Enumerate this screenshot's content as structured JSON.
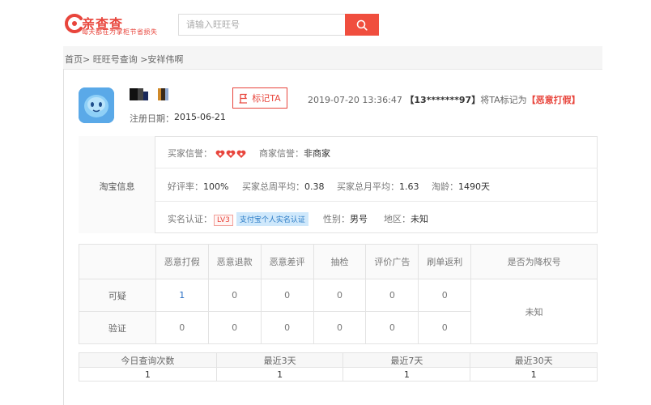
{
  "brand": {
    "title": "亲查查",
    "slogan": "每天都在为掌柜节省损失",
    "color": "#e8453c"
  },
  "search": {
    "placeholder": "请输入旺旺号"
  },
  "breadcrumb": {
    "text": "首页> 旺旺号查询 >安祥伟啊"
  },
  "profile": {
    "reg_label": "注册日期：",
    "reg_date": "2015-06-21",
    "mark_button": "标记TA",
    "record": {
      "time": "2019-07-20 13:36:47",
      "account": "【13*******97】",
      "action": "将TA标记为",
      "tag": "【恶意打假】"
    }
  },
  "taobao_info": {
    "section_label": "淘宝信息",
    "buyer_credit_label": "买家信誉：",
    "seller_credit_label": "商家信誉：",
    "seller_credit_value": "非商家",
    "good_rate_label": "好评率：",
    "good_rate_value": "100%",
    "weekly_avg_label": "买家总周平均：",
    "weekly_avg_value": "0.38",
    "monthly_avg_label": "买家总月平均：",
    "monthly_avg_value": "1.63",
    "age_label": "淘龄：",
    "age_value": "1490天",
    "realname_label": "实名认证：",
    "level_badge": "LV3",
    "alipay_badge": "支付宝个人实名认证",
    "gender_label": "性别：",
    "gender_value": "男号",
    "region_label": "地区：",
    "region_value": "未知"
  },
  "stats_table": {
    "headers": [
      "恶意打假",
      "恶意退款",
      "恶意差评",
      "抽检",
      "评价广告",
      "刷单返利",
      "是否为降权号"
    ],
    "rows": [
      {
        "label": "可疑",
        "values": [
          "1",
          "0",
          "0",
          "0",
          "0",
          "0"
        ]
      },
      {
        "label": "验证",
        "values": [
          "0",
          "0",
          "0",
          "0",
          "0",
          "0"
        ]
      }
    ],
    "demotion_value": "未知"
  },
  "query_table": {
    "headers": [
      "今日查询次数",
      "最近3天",
      "最近7天",
      "最近30天"
    ],
    "values": [
      "1",
      "1",
      "1",
      "1"
    ]
  }
}
